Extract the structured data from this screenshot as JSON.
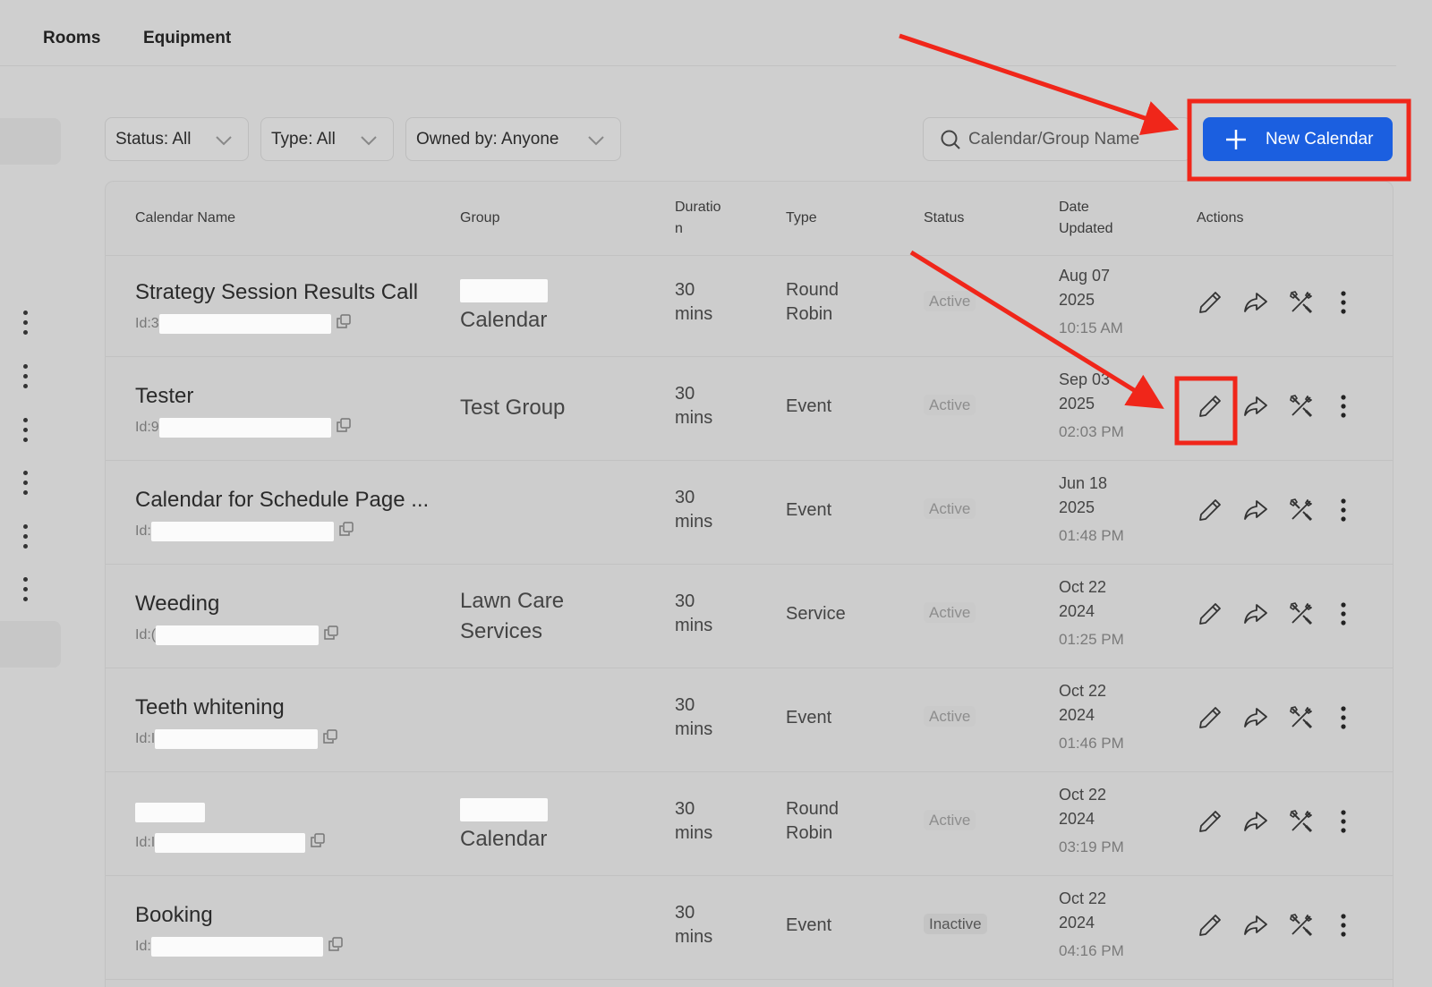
{
  "tabs": [
    "Rooms",
    "Equipment"
  ],
  "filters": {
    "status": "Status: All",
    "type": "Type: All",
    "owner": "Owned by: Anyone"
  },
  "search": {
    "placeholder": "Calendar/Group Name"
  },
  "new_calendar_label": "New Calendar",
  "columns": {
    "name": "Calendar Name",
    "group": "Group",
    "duration_1": "Duratio",
    "duration_2": "n",
    "type": "Type",
    "status": "Status",
    "date_1": "Date",
    "date_2": "Updated",
    "actions": "Actions"
  },
  "id_prefix": "Id:",
  "rows": [
    {
      "name": "Strategy Session Results Call",
      "id_char": "3",
      "group_line1": "",
      "group_line2": "Calendar",
      "dur1": "30",
      "dur2": "mins",
      "type1": "Round",
      "type2": "Robin",
      "status": "Active",
      "date1": "Aug 07",
      "date2": "2025",
      "time": "10:15 AM"
    },
    {
      "name": "Tester",
      "id_char": "9",
      "group_line1": "Test Group",
      "group_line2": "",
      "dur1": "30",
      "dur2": "mins",
      "type1": "Event",
      "type2": "",
      "status": "Active",
      "date1": "Sep 03",
      "date2": "2025",
      "time": "02:03 PM"
    },
    {
      "name": "Calendar for Schedule Page ...",
      "id_char": "",
      "group_line1": "",
      "group_line2": "",
      "dur1": "30",
      "dur2": "mins",
      "type1": "Event",
      "type2": "",
      "status": "Active",
      "date1": "Jun 18",
      "date2": "2025",
      "time": "01:48 PM"
    },
    {
      "name": "Weeding",
      "id_char": "(",
      "group_line1": "Lawn Care",
      "group_line2": "Services",
      "dur1": "30",
      "dur2": "mins",
      "type1": "Service",
      "type2": "",
      "status": "Active",
      "date1": "Oct 22",
      "date2": "2024",
      "time": "01:25 PM"
    },
    {
      "name": "Teeth whitening",
      "id_char": "I",
      "group_line1": "",
      "group_line2": "",
      "dur1": "30",
      "dur2": "mins",
      "type1": "Event",
      "type2": "",
      "status": "Active",
      "date1": "Oct 22",
      "date2": "2024",
      "time": "01:46 PM"
    },
    {
      "name": "",
      "id_char": "I",
      "group_line1": "",
      "group_line2": "Calendar",
      "dur1": "30",
      "dur2": "mins",
      "type1": "Round",
      "type2": "Robin",
      "status": "Active",
      "date1": "Oct 22",
      "date2": "2024",
      "time": "03:19 PM"
    },
    {
      "name": "Booking",
      "id_char": "",
      "group_line1": "",
      "group_line2": "",
      "dur1": "30",
      "dur2": "mins",
      "type1": "Event",
      "type2": "",
      "status": "Inactive",
      "date1": "Oct 22",
      "date2": "2024",
      "time": "04:16 PM"
    }
  ],
  "colors": {
    "primary": "#1b5fe0",
    "annotation": "#f0261a"
  }
}
